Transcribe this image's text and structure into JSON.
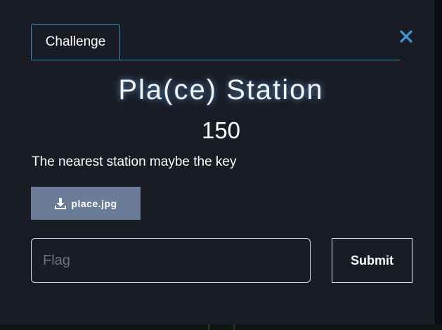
{
  "modal": {
    "tab_label": "Challenge",
    "close_icon": "close-icon",
    "title": "Pla(ce) Station",
    "points": "150",
    "description": "The nearest station maybe the key",
    "file": {
      "label": "place.jpg",
      "icon": "download-icon"
    },
    "flag_input": {
      "placeholder": "Flag",
      "value": ""
    },
    "submit_label": "Submit"
  },
  "colors": {
    "modal_bg": "#1a1c25",
    "accent": "#2a8fc0",
    "close": "#3a9bd8",
    "file_button_bg": "#6a7c98",
    "text": "#ffffff"
  }
}
